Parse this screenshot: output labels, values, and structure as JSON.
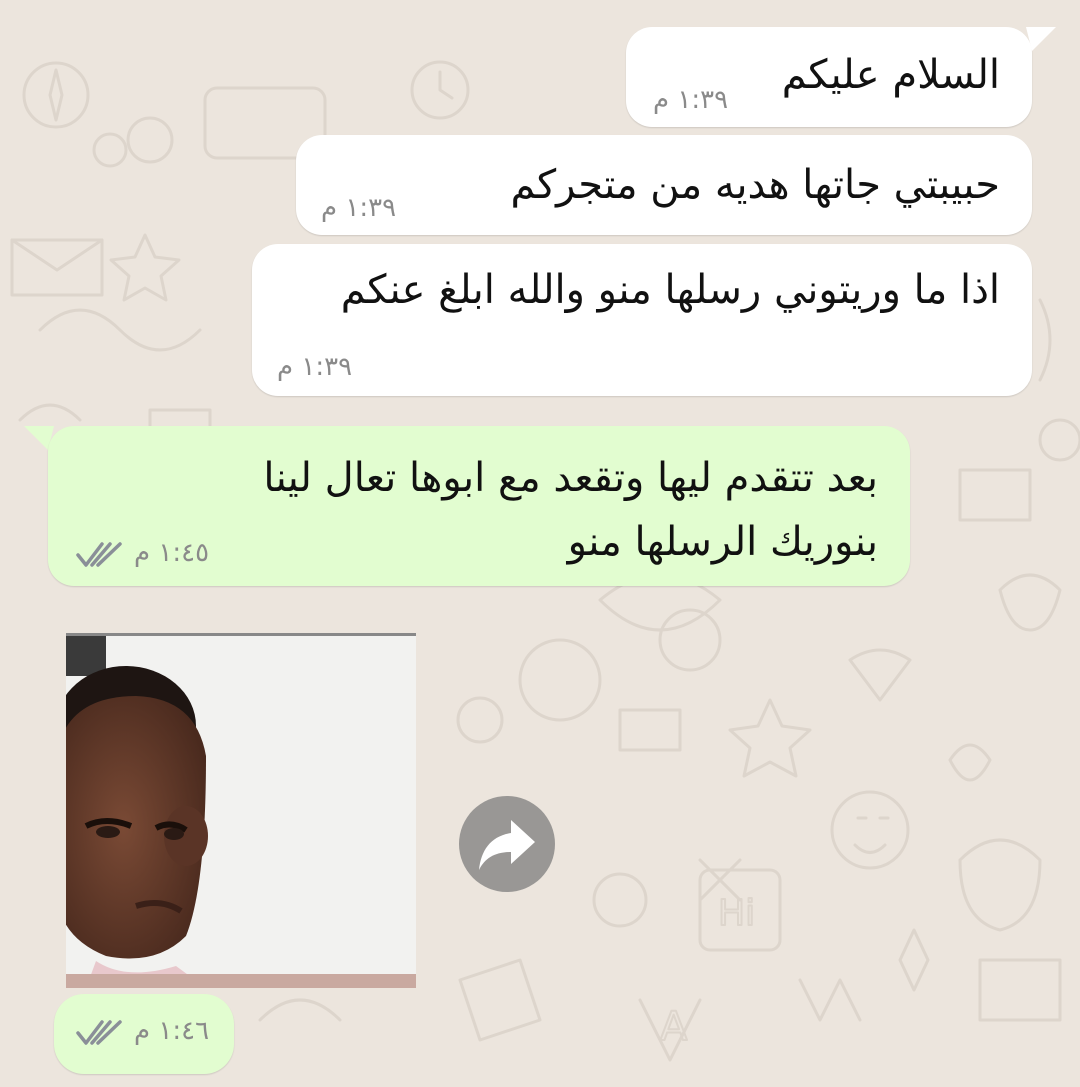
{
  "chat": {
    "messages": [
      {
        "direction": "incoming",
        "lines": [
          "السلام عليكم"
        ],
        "time": "١:٣٩ م"
      },
      {
        "direction": "incoming",
        "lines": [
          "حبيبتي جاتها هديه من متجركم"
        ],
        "time": "١:٣٩ م"
      },
      {
        "direction": "incoming",
        "lines": [
          "اذا ما وريتوني رسلها منو والله ابلغ عنكم"
        ],
        "time": "١:٣٩ م"
      },
      {
        "direction": "outgoing",
        "lines": [
          "بعد تتقدم ليها وتقعد مع ابوها تعال لينا",
          "بنوريك الرسلها منو"
        ],
        "time": "١:٤٥ م",
        "status": "read"
      },
      {
        "direction": "outgoing",
        "type": "image",
        "image_subject": "child-photo",
        "time": "١:٤٦ م",
        "status": "read"
      }
    ],
    "forward_icon": "forward-arrow-icon"
  },
  "colors": {
    "background": "#ece5dd",
    "incoming_bubble": "#ffffff",
    "outgoing_bubble": "#e2fdd0",
    "read_ticks": "#8a8f98"
  }
}
